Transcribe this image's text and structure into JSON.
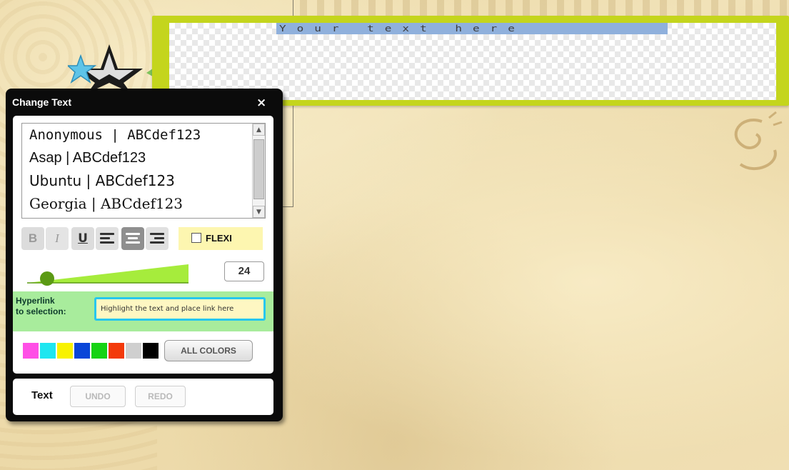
{
  "canvas": {
    "text_placeholder": "Your text here",
    "frame_color": "#c4d51d"
  },
  "panel": {
    "title": "Change Text",
    "close_label": "×",
    "fonts": [
      {
        "label": "Anonymous | ABCdef123"
      },
      {
        "label": "Asap | ABCdef123"
      },
      {
        "label": "Ubuntu | ABCdef123"
      },
      {
        "label": "Georgia | ABCdef123"
      }
    ],
    "scroll_up": "▲",
    "scroll_down": "▼",
    "toolbar": {
      "bold": "B",
      "italic": "I",
      "underline": "U",
      "flexi": "FLEXI"
    },
    "size": {
      "value": "24",
      "slider_level": 0.05
    },
    "hyperlink": {
      "label_line1": "Hyperlink",
      "label_line2": "to selection:",
      "placeholder": "Highlight the text and place link here"
    },
    "colors": [
      "#ff4fe6",
      "#1ee6f0",
      "#f8f200",
      "#0a46d8",
      "#16d314",
      "#f33a0a",
      "#cfcfcf",
      "#000000"
    ],
    "all_colors_label": "ALL COLORS",
    "footer": {
      "label": "Text",
      "undo": "UNDO",
      "redo": "REDO"
    }
  }
}
